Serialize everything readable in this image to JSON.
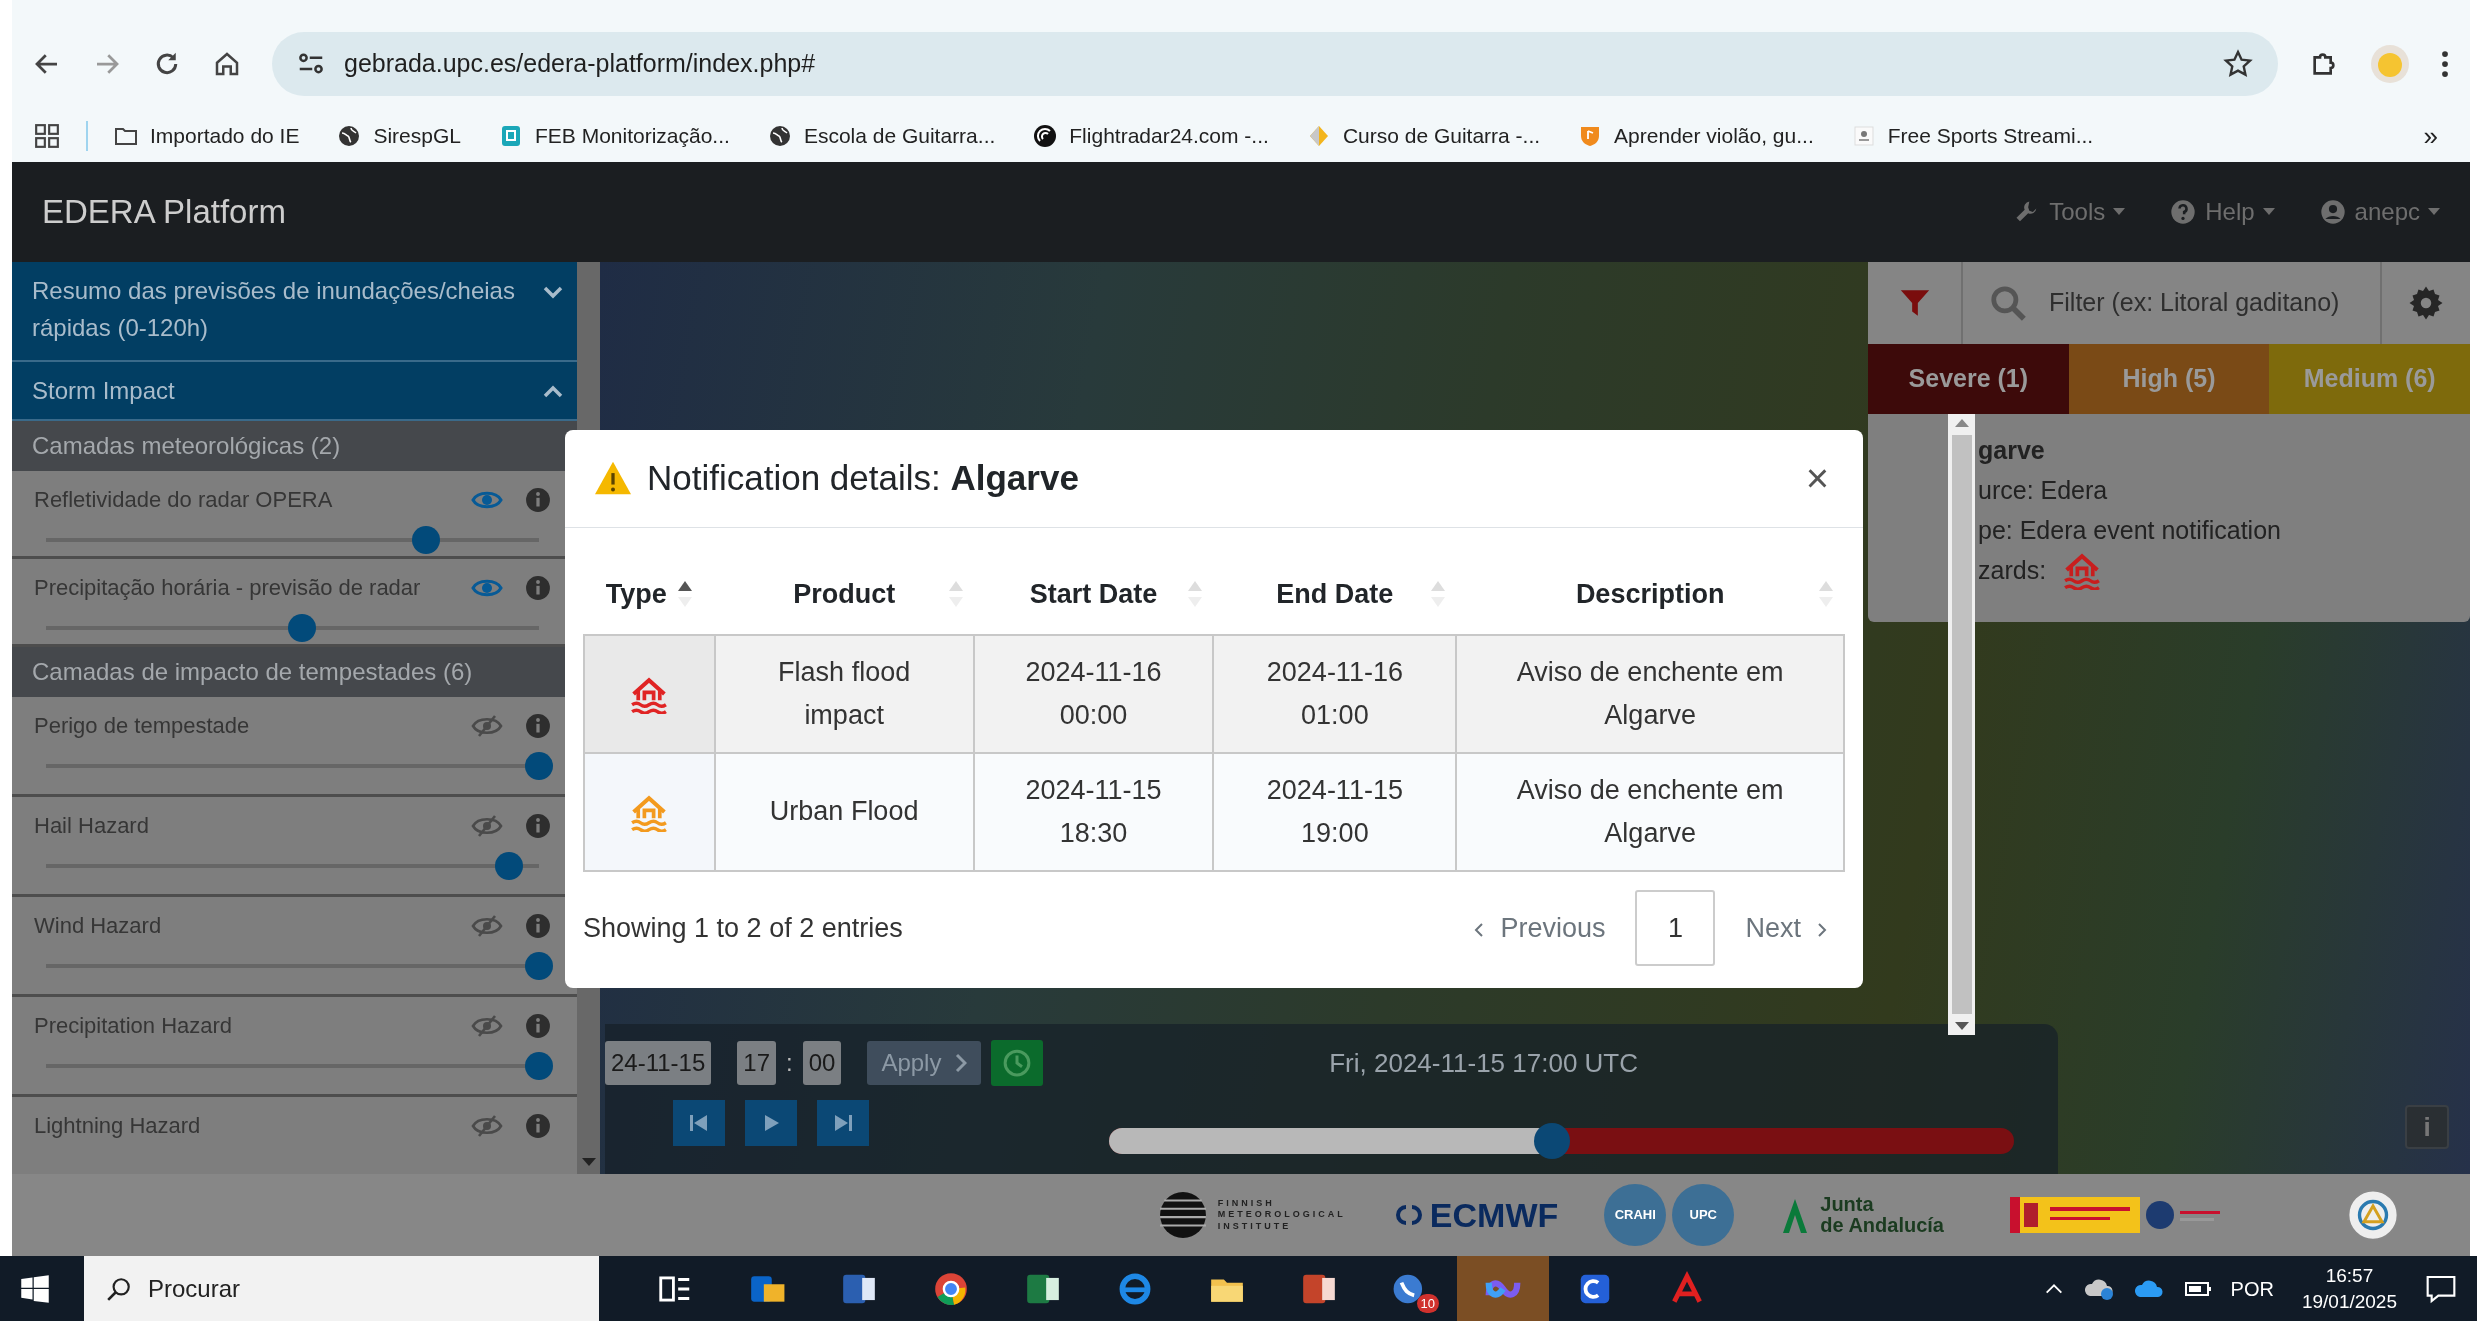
{
  "browser": {
    "url": "gebrada.upc.es/edera-platform/index.php#",
    "bookmarks": [
      {
        "label": "Importado do IE",
        "kind": "folder"
      },
      {
        "label": "SirespGL",
        "kind": "globe"
      },
      {
        "label": "FEB Monitorização...",
        "kind": "shield"
      },
      {
        "label": "Escola de Guitarra...",
        "kind": "globe"
      },
      {
        "label": "Flightradar24.com -...",
        "kind": "radar"
      },
      {
        "label": "Curso de Guitarra -...",
        "kind": "diamond"
      },
      {
        "label": "Aprender violão, gu...",
        "kind": "badge"
      },
      {
        "label": "Free Sports Streami...",
        "kind": "page"
      }
    ],
    "overflow": "»"
  },
  "navbar": {
    "brand": "EDERA Platform",
    "menus": [
      {
        "label": "Tools",
        "kind": "tools"
      },
      {
        "label": "Help",
        "kind": "help"
      },
      {
        "label": "anepc",
        "kind": "user"
      }
    ]
  },
  "sidebar": {
    "sections": [
      {
        "title": "Resumo das previsões de inundações/cheias rápidas (0-120h)",
        "expanded": false
      },
      {
        "title": "Storm Impact",
        "expanded": true
      }
    ],
    "groups": [
      {
        "title": "Camadas meteorológicas (2)",
        "layers": [
          {
            "name": "Refletividade do radar OPERA",
            "visible": true,
            "level": 0.77
          },
          {
            "name": "Precipitação horária - previsão de radar",
            "visible": true,
            "level": 0.52
          }
        ]
      },
      {
        "title": "Camadas de impacto de tempestades (6)",
        "layers": [
          {
            "name": "Perigo de tempestade",
            "visible": false,
            "level": 1
          },
          {
            "name": "Hail Hazard",
            "visible": false,
            "level": 0.94
          },
          {
            "name": "Wind Hazard",
            "visible": false,
            "level": 1
          },
          {
            "name": "Precipitation Hazard",
            "visible": false,
            "level": 1
          },
          {
            "name": "Lightning Hazard",
            "visible": false
          }
        ]
      }
    ]
  },
  "timeline": {
    "date": "24-11-15",
    "hour": "17",
    "separator": ":",
    "minute": "00",
    "apply": "Apply",
    "current": "Fri, 2024-11-15 17:00 UTC",
    "level": 0.49
  },
  "alerts_panel": {
    "filter_placeholder": "Filter (ex: Litoral gaditano)",
    "tabs": [
      {
        "label": "Severe (1)",
        "color": "#3d0a0a"
      },
      {
        "label": "High (5)",
        "color": "#7a4a16"
      },
      {
        "label": "Medium (6)",
        "color": "#7e6a0c"
      }
    ],
    "card": {
      "title": "garve",
      "lines": [
        "urce: Edera",
        "pe: Edera event notification"
      ],
      "hazards_label": "zards:"
    }
  },
  "modal": {
    "title": "Notification details: **Algarve**",
    "close": "×",
    "columns": [
      {
        "label": "Type",
        "sorted": true
      },
      {
        "label": "Product",
        "sorted": false
      },
      {
        "label": "Start Date",
        "sorted": false
      },
      {
        "label": "End Date",
        "sorted": false
      },
      {
        "label": "Description",
        "sorted": false
      }
    ],
    "rows": [
      {
        "color": "#e02424",
        "product": "Flash flood impact",
        "start": "2024-11-16 00:00",
        "end": "2024-11-16 01:00",
        "description": "Aviso de enchente em Algarve"
      },
      {
        "color": "#f39a1e",
        "product": "Urban Flood",
        "start": "2024-11-15 18:30",
        "end": "2024-11-15 19:00",
        "description": "Aviso de enchente em Algarve"
      }
    ],
    "info": "Showing 1 to 2 of 2 entries",
    "pagination": [
      {
        "label": "Previous",
        "kind": "prev",
        "selected": false
      },
      {
        "label": "1",
        "kind": "page",
        "selected": true
      },
      {
        "label": "Next",
        "kind": "next",
        "selected": false
      }
    ]
  },
  "map_info_button": "i",
  "logos": [
    {
      "kind": "fmi",
      "lines": [
        "FINNISH",
        "METEOROLOGICAL",
        "INSTITUTE"
      ]
    },
    {
      "kind": "ecmwf",
      "lines": [
        "ECMWF"
      ]
    },
    {
      "kind": "crahi",
      "lines": [
        "CRAHI"
      ]
    },
    {
      "kind": "upc",
      "lines": [
        "UPC"
      ]
    },
    {
      "kind": "junta",
      "lines": [
        "Junta",
        "de Andalucía"
      ]
    },
    {
      "kind": "gov"
    },
    {
      "kind": "seal"
    }
  ],
  "taskbar": {
    "search": "Procurar",
    "apps": [
      {
        "kind": "taskview",
        "active": false
      },
      {
        "kind": "mail",
        "active": false
      },
      {
        "kind": "doc",
        "active": false
      },
      {
        "kind": "browser",
        "active": false
      },
      {
        "kind": "sheet",
        "active": false
      },
      {
        "kind": "web",
        "active": false
      },
      {
        "kind": "folder",
        "active": false
      },
      {
        "kind": "slides",
        "active": false
      },
      {
        "kind": "phone",
        "active": false,
        "badge": "10"
      },
      {
        "kind": "loop",
        "active": true
      },
      {
        "kind": "remote",
        "active": false
      },
      {
        "kind": "pdf",
        "active": false
      }
    ],
    "language": "POR",
    "time": "16:57",
    "date": "19/01/2025"
  }
}
